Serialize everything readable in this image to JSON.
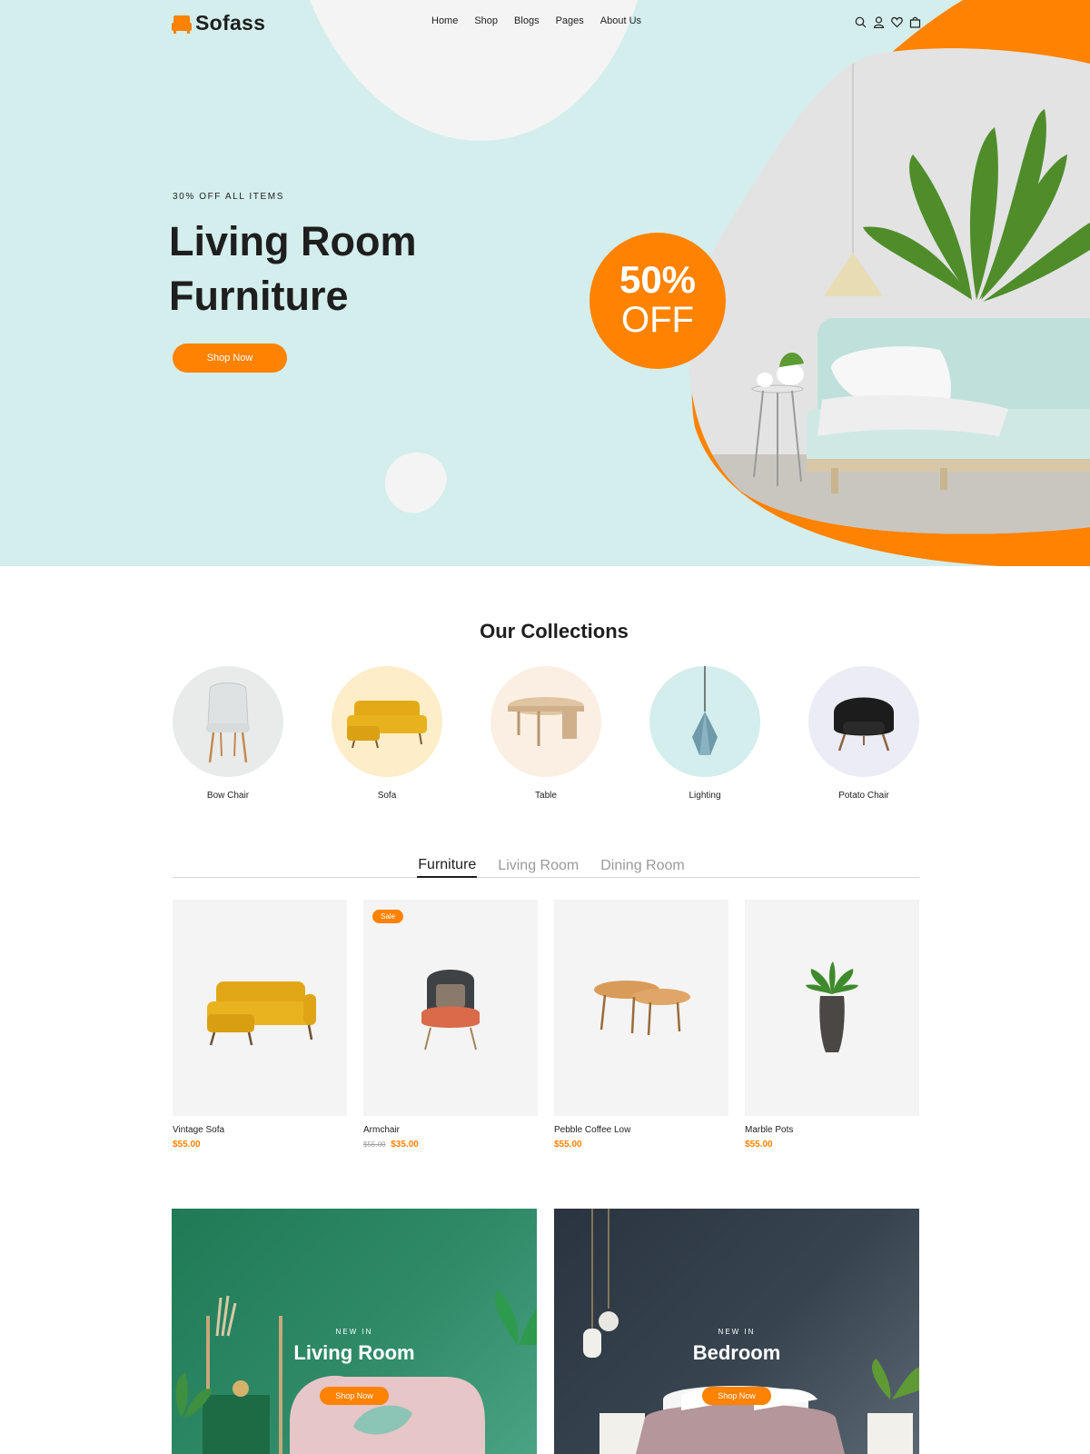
{
  "brand": {
    "name": "Sofass",
    "accent": "#ff8200"
  },
  "nav": {
    "items": [
      "Home",
      "Shop",
      "Blogs",
      "Pages",
      "About Us"
    ]
  },
  "header_icons": [
    "search-icon",
    "user-icon",
    "heart-icon",
    "cart-icon"
  ],
  "hero": {
    "eyebrow": "30% OFF ALL ITEMS",
    "title_line1": "Living Room",
    "title_line2": "Furniture",
    "cta": "Shop Now",
    "badge_line1": "50%",
    "badge_line2": "OFF"
  },
  "collections": {
    "title": "Our Collections",
    "items": [
      {
        "name": "Bow Chair",
        "bg": "#e9ebeb"
      },
      {
        "name": "Sofa",
        "bg": "#fdedc8"
      },
      {
        "name": "Table",
        "bg": "#faefe2"
      },
      {
        "name": "Lighting",
        "bg": "#d3eeec"
      },
      {
        "name": "Potato Chair",
        "bg": "#ececf6"
      }
    ]
  },
  "tabs": {
    "items": [
      "Furniture",
      "Living Room",
      "Dining Room"
    ],
    "active": "Furniture"
  },
  "products": [
    {
      "name": "Vintage Sofa",
      "price": "$55.00"
    },
    {
      "name": "Armchair",
      "badge": "Sale",
      "old_price": "$55.00",
      "price": "$35.00"
    },
    {
      "name": "Pebble Coffee Low",
      "price": "$55.00"
    },
    {
      "name": "Marble Pots",
      "price": "$55.00"
    }
  ],
  "banners": [
    {
      "eyebrow": "NEW IN",
      "title": "Living Room",
      "cta": "Shop Now"
    },
    {
      "eyebrow": "NEW IN",
      "title": "Bedroom",
      "cta": "Shop Now"
    }
  ]
}
